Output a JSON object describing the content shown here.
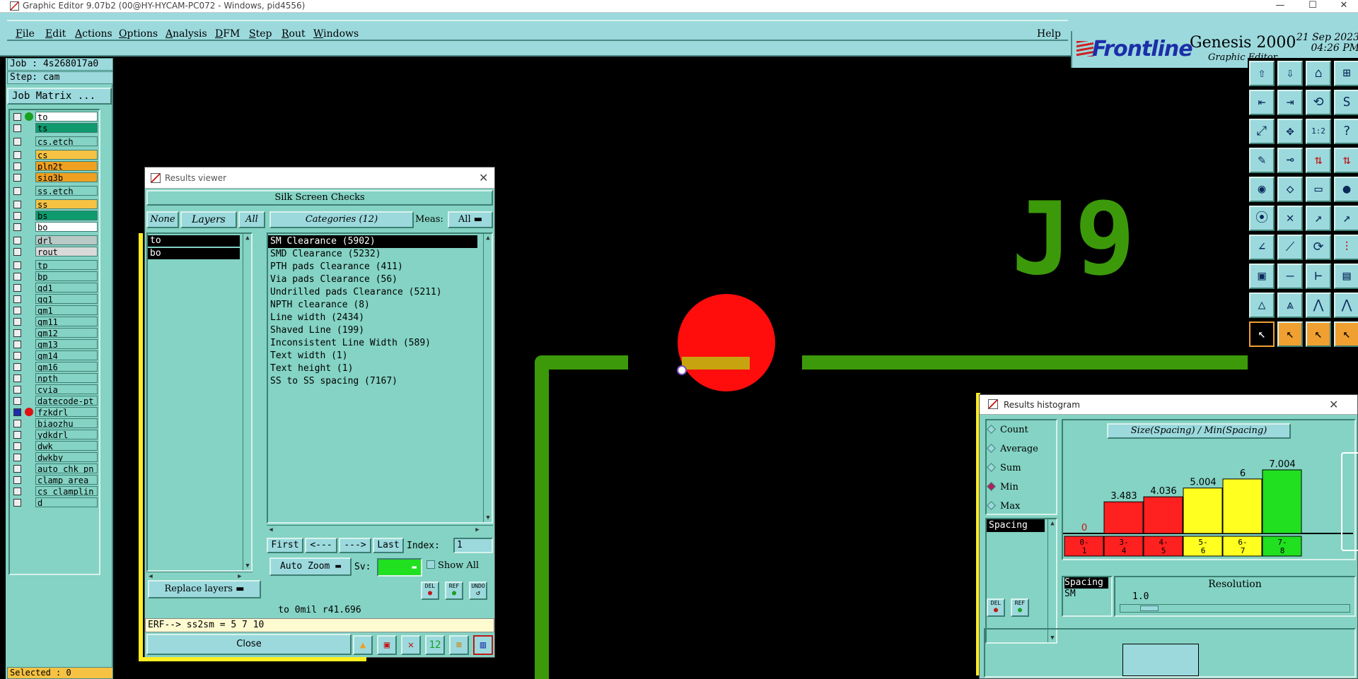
{
  "window": {
    "title": "Graphic Editor 9.07b2 (00@HY-HYCAM-PC072 - Windows, pid4556)",
    "minimize": "—",
    "maximize": "☐",
    "close": "✕"
  },
  "menu": {
    "items": [
      {
        "label": "File",
        "ul": "F",
        "rest": "ile"
      },
      {
        "label": "Edit",
        "ul": "E",
        "rest": "dit"
      },
      {
        "label": "Actions",
        "ul": "A",
        "rest": "ctions"
      },
      {
        "label": "Options",
        "ul": "O",
        "rest": "ptions"
      },
      {
        "label": "Analysis",
        "ul": "A",
        "rest": "nalysis"
      },
      {
        "label": "DFM",
        "ul": "D",
        "rest": "FM"
      },
      {
        "label": "Step",
        "ul": "S",
        "rest": "tep"
      },
      {
        "label": "Rout",
        "ul": "R",
        "rest": "out"
      },
      {
        "label": "Windows",
        "ul": "W",
        "rest": "indows"
      }
    ],
    "help": "Help"
  },
  "brand": {
    "logo": "Frontline",
    "product": "Genesis 2000",
    "sub": "Graphic Editor",
    "date": "21 Sep 2023",
    "time": "04:26 PM"
  },
  "left": {
    "job": "Job : 4s268017a0",
    "step": "Step: cam",
    "job_matrix": "Job Matrix ...",
    "selected": "Selected : 0",
    "layers": [
      {
        "name": "to",
        "bg": "#ffffff",
        "dot": "#1aa020"
      },
      {
        "name": "ts",
        "bg": "#0f9a6e",
        "dot": ""
      },
      {
        "name": "cs.etch",
        "bg": "#84d3c4",
        "dot": "",
        "gap": 1
      },
      {
        "name": "cs",
        "bg": "#f5c243",
        "dot": "",
        "gap": 1
      },
      {
        "name": "pln2t",
        "bg": "#f0a020",
        "dot": ""
      },
      {
        "name": "sig3b",
        "bg": "#f0a020",
        "dot": ""
      },
      {
        "name": "ss.etch",
        "bg": "#84d3c4",
        "dot": "",
        "gap": 1
      },
      {
        "name": "ss",
        "bg": "#f5c243",
        "dot": "",
        "gap": 1
      },
      {
        "name": "bs",
        "bg": "#0f9a6e",
        "dot": ""
      },
      {
        "name": "bo",
        "bg": "#ffffff",
        "dot": ""
      },
      {
        "name": "drl",
        "bg": "#b9c9c6",
        "dot": "",
        "gap": 1
      },
      {
        "name": "rout",
        "bg": "#d9d9d9",
        "dot": ""
      },
      {
        "name": "tp",
        "bg": "#84d3c4",
        "dot": "",
        "gap": 1
      },
      {
        "name": "bp",
        "bg": "#84d3c4",
        "dot": ""
      },
      {
        "name": "gd1",
        "bg": "#84d3c4",
        "dot": ""
      },
      {
        "name": "gg1",
        "bg": "#84d3c4",
        "dot": ""
      },
      {
        "name": "gm1",
        "bg": "#84d3c4",
        "dot": ""
      },
      {
        "name": "gm11",
        "bg": "#84d3c4",
        "dot": ""
      },
      {
        "name": "gm12",
        "bg": "#84d3c4",
        "dot": ""
      },
      {
        "name": "gm13",
        "bg": "#84d3c4",
        "dot": ""
      },
      {
        "name": "gm14",
        "bg": "#84d3c4",
        "dot": ""
      },
      {
        "name": "gm16",
        "bg": "#84d3c4",
        "dot": ""
      },
      {
        "name": "npth",
        "bg": "#84d3c4",
        "dot": ""
      },
      {
        "name": "cvia",
        "bg": "#84d3c4",
        "dot": ""
      },
      {
        "name": "datecode-pt",
        "bg": "#84d3c4",
        "dot": ""
      },
      {
        "name": "fzkdrl",
        "bg": "#84d3c4",
        "dot": "#e01010",
        "cbblue": 1
      },
      {
        "name": "biaozhu",
        "bg": "#84d3c4",
        "dot": ""
      },
      {
        "name": "ydkdrl",
        "bg": "#84d3c4",
        "dot": ""
      },
      {
        "name": "dwk",
        "bg": "#84d3c4",
        "dot": ""
      },
      {
        "name": "dwkby",
        "bg": "#84d3c4",
        "dot": ""
      },
      {
        "name": "auto_chk_pn",
        "bg": "#84d3c4",
        "dot": ""
      },
      {
        "name": "clamp_area",
        "bg": "#84d3c4",
        "dot": ""
      },
      {
        "name": "cs_clamplin",
        "bg": "#84d3c4",
        "dot": ""
      },
      {
        "name": "d",
        "bg": "#84d3c4",
        "dot": ""
      }
    ]
  },
  "canvas": {
    "label": "J9"
  },
  "results_viewer": {
    "title": "Results viewer",
    "heading": "Silk Screen Checks",
    "none": "None",
    "layers": "Layers",
    "all": "All",
    "categories": "Categories (12)",
    "meas_label": "Meas:",
    "meas_value": "All",
    "layer_items": [
      "to",
      "bo"
    ],
    "category_items": [
      "SM Clearance (5902)",
      "SMD Clearance (5232)",
      "PTH pads Clearance (411)",
      "Via pads Clearance (56)",
      "Undrilled pads Clearance (5211)",
      "NPTH clearance (8)",
      "Line width (2434)",
      "Shaved Line (199)",
      "Inconsistent Line Width (589)",
      "Text width (1)",
      "Text height (1)",
      "SS to SS spacing (7167)"
    ],
    "first": "First",
    "prev": "<---",
    "next": "--->",
    "last": "Last",
    "index_label": "Index:",
    "index_value": "1",
    "auto_zoom": "Auto Zoom",
    "sv_label": "Sv:",
    "show_all": "Show All",
    "replace_layers": "Replace layers",
    "del": "DEL",
    "ref": "REF",
    "undo": "UNDO",
    "status": "to 0mil  r41.696",
    "erf": "ERF--> ss2sm = 5 7 10",
    "close": "Close"
  },
  "histogram": {
    "title": "Results histogram",
    "options": [
      {
        "label": "Count",
        "on": false
      },
      {
        "label": "Average",
        "on": false
      },
      {
        "label": "Sum",
        "on": false
      },
      {
        "label": "Min",
        "on": true
      },
      {
        "label": "Max",
        "on": false
      }
    ],
    "chart_title": "Size(Spacing) / Min(Spacing)",
    "list_item": "Spacing",
    "del": "DEL",
    "ref": "REF",
    "info_line1": "Spacing",
    "info_line2": "SM",
    "resolution_label": "Resolution",
    "resolution_value": "1.0",
    "bars": [
      {
        "cat_top": "0-",
        "cat_bot": "1",
        "value": 0,
        "label": "0",
        "color": "#ff2020"
      },
      {
        "cat_top": "3-",
        "cat_bot": "4",
        "value": 3.483,
        "label": "3.483",
        "color": "#ff2020"
      },
      {
        "cat_top": "4-",
        "cat_bot": "5",
        "value": 4.036,
        "label": "4.036",
        "color": "#ff2020"
      },
      {
        "cat_top": "5-",
        "cat_bot": "6",
        "value": 5.004,
        "label": "5.004",
        "color": "#ffff20"
      },
      {
        "cat_top": "6-",
        "cat_bot": "7",
        "value": 6,
        "label": "6",
        "color": "#ffff20"
      },
      {
        "cat_top": "7-",
        "cat_bot": "8",
        "value": 7.004,
        "label": "7.004",
        "color": "#20e020"
      }
    ]
  }
}
